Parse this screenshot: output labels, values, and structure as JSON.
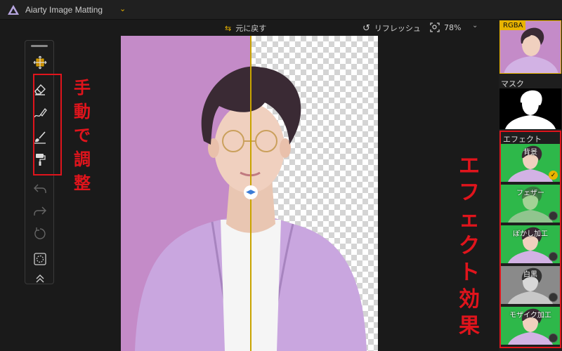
{
  "app": {
    "title": "Aiarty Image Matting"
  },
  "toolbar": {
    "undo_original_label": "元に戻す",
    "refresh_label": "リフレッシュ",
    "zoom_level": "78%"
  },
  "annotations": {
    "manual_adjust": [
      "手",
      "動",
      "で",
      "調",
      "整"
    ],
    "effect_effects": [
      "エ",
      "フ",
      "ェ",
      "ク",
      "ト",
      "効",
      "果"
    ]
  },
  "right_panel": {
    "rgba_label": "RGBA",
    "mask_label": "マスク",
    "effect_label": "エフェクト",
    "effects": [
      {
        "name": "背景",
        "selected": true
      },
      {
        "name": "フェザー",
        "selected": false
      },
      {
        "name": "ぼかし加工",
        "selected": false
      },
      {
        "name": "白黒",
        "selected": false
      },
      {
        "name": "モザイク加工",
        "selected": false
      }
    ]
  },
  "colors": {
    "accent": "#e8b400",
    "annotation_red": "#e0141c",
    "backdrop": "#c48bc8",
    "effect_green": "#2eb84a"
  },
  "icons": [
    "move-icon",
    "eraser-icon",
    "brush-icon",
    "smart-brush-icon",
    "fill-roller-icon",
    "undo-icon",
    "redo-icon",
    "reset-icon",
    "select-icon",
    "collapse-icon"
  ]
}
